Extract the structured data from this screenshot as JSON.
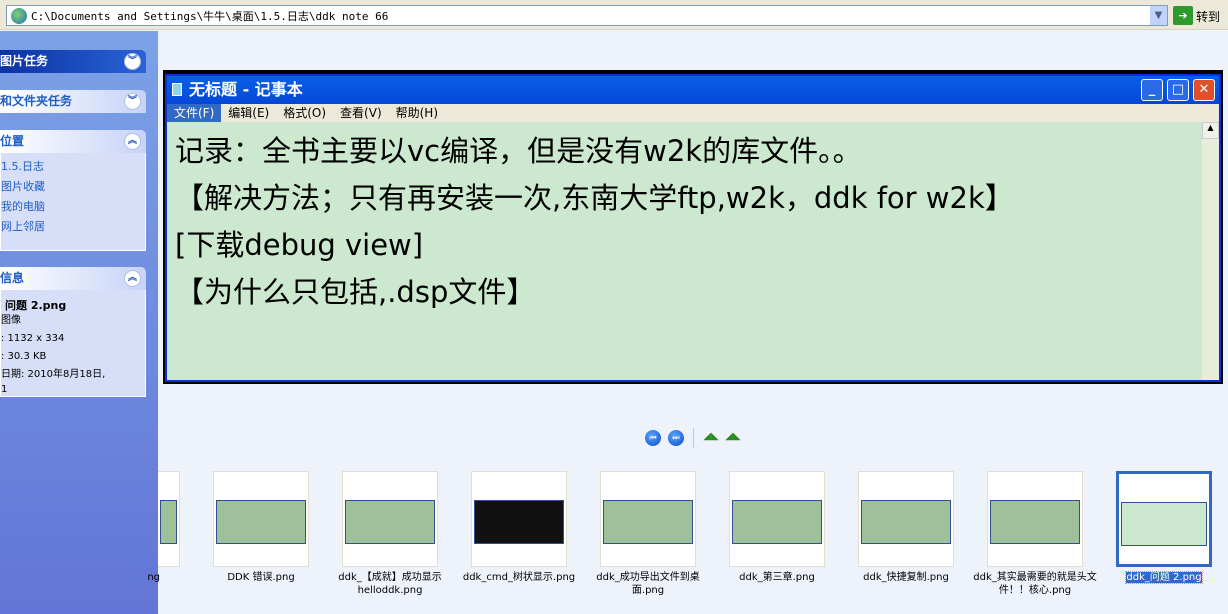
{
  "address": {
    "path": "C:\\Documents and Settings\\牛牛\\桌面\\1.5.日志\\ddk note 66",
    "go_label": "转到"
  },
  "sidebar": {
    "picture_tasks": "图片任务",
    "file_folder_tasks": "和文件夹任务",
    "places": {
      "title": "位置",
      "items": [
        "1.5.日志",
        "图片收藏",
        "我的电脑",
        "网上邻居"
      ]
    },
    "details": {
      "title": "信息",
      "name": "问题 2.png",
      "type": "图像",
      "dimensions": ": 1132 x 334",
      "size": ": 30.3 KB",
      "date": "日期: 2010年8月18日,",
      "date_cont": "1"
    }
  },
  "notepad": {
    "title": "无标题 - 记事本",
    "menu": [
      "文件(F)",
      "编辑(E)",
      "格式(O)",
      "查看(V)",
      "帮助(H)"
    ],
    "lines": [
      "记录：全书主要以vc编译，但是没有w2k的库文件。。",
      "【解决方法；只有再安装一次,东南大学ftp,w2k，ddk for w2k】",
      "[下载debug view]",
      "【为什么只包括,.dsp文件】"
    ]
  },
  "thumbnails": [
    {
      "caption": "ng"
    },
    {
      "caption": "DDK 错误.png"
    },
    {
      "caption": "ddk_【成就】成功显示helloddk.png"
    },
    {
      "caption": "ddk_cmd_树状显示.png"
    },
    {
      "caption": "ddk_成功导出文件到桌面.png"
    },
    {
      "caption": "ddk_第三章.png"
    },
    {
      "caption": "ddk_快捷复制.png"
    },
    {
      "caption": "ddk_其实最需要的就是头文件！！核心.png"
    },
    {
      "caption": "ddk_问题 2.png",
      "selected": true
    }
  ]
}
